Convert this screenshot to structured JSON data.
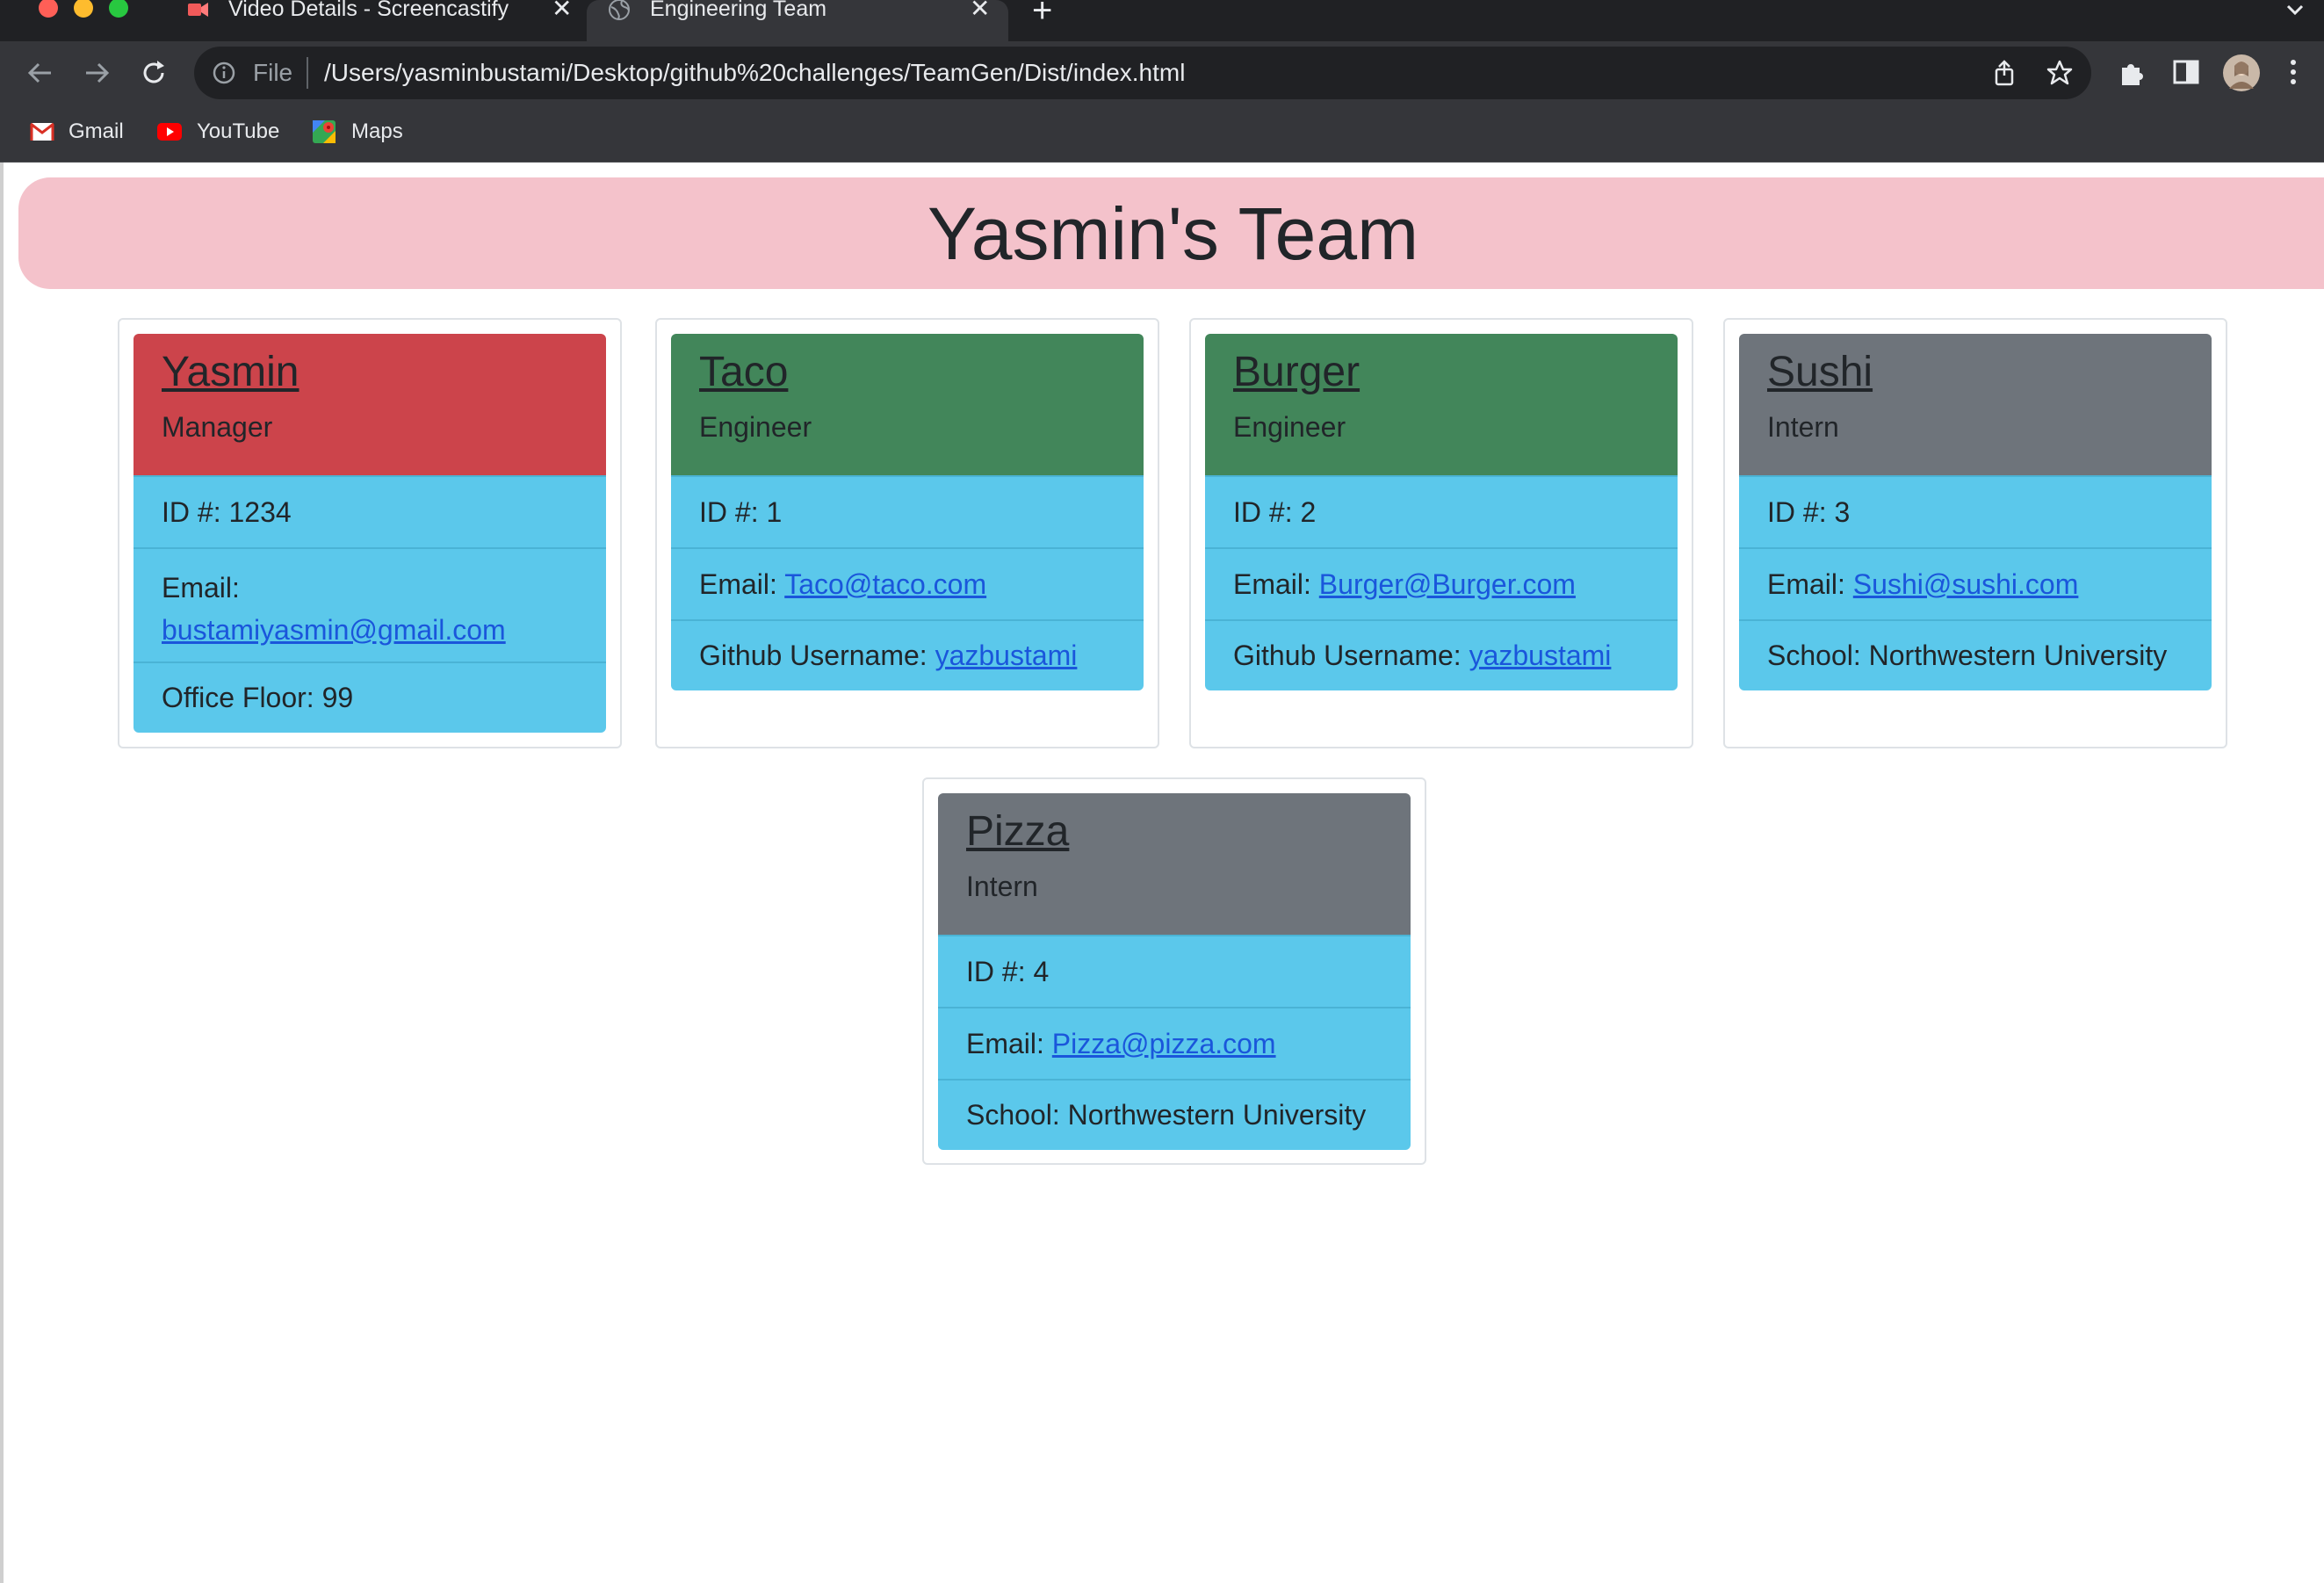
{
  "browser": {
    "tabs": [
      {
        "title": "Video Details - Screencastify",
        "active": false
      },
      {
        "title": "Engineering Team",
        "active": true
      }
    ],
    "address": {
      "scheme_label": "File",
      "url": "/Users/yasminbustami/Desktop/github%20challenges/TeamGen/Dist/index.html"
    },
    "bookmarks": [
      {
        "label": "Gmail",
        "icon": "gmail-icon"
      },
      {
        "label": "YouTube",
        "icon": "youtube-icon"
      },
      {
        "label": "Maps",
        "icon": "maps-icon"
      }
    ]
  },
  "page": {
    "title": "Yasmin's Team",
    "cards": [
      {
        "name": "Yasmin",
        "role": "Manager",
        "header_color": "#cc444b",
        "rows": [
          {
            "label": "ID #:",
            "value": "1234"
          },
          {
            "label": "Email:",
            "value": "bustamiyasmin@gmail.com",
            "link": true
          },
          {
            "label": "Office Floor:",
            "value": "99"
          }
        ]
      },
      {
        "name": "Taco",
        "role": "Engineer",
        "header_color": "#42865a",
        "rows": [
          {
            "label": "ID #:",
            "value": "1"
          },
          {
            "label": "Email:",
            "value": "Taco@taco.com",
            "link": true
          },
          {
            "label": "Github Username:",
            "value": "yazbustami",
            "link": true
          }
        ]
      },
      {
        "name": "Burger",
        "role": "Engineer",
        "header_color": "#42865a",
        "rows": [
          {
            "label": "ID #:",
            "value": "2"
          },
          {
            "label": "Email:",
            "value": "Burger@Burger.com",
            "link": true
          },
          {
            "label": "Github Username:",
            "value": "yazbustami",
            "link": true
          }
        ]
      },
      {
        "name": "Sushi",
        "role": "Intern",
        "header_color": "#6e747b",
        "rows": [
          {
            "label": "ID #:",
            "value": "3"
          },
          {
            "label": "Email:",
            "value": "Sushi@sushi.com",
            "link": true
          },
          {
            "label": "School:",
            "value": "Northwestern University"
          }
        ]
      },
      {
        "name": "Pizza",
        "role": "Intern",
        "header_color": "#6e747b",
        "rows": [
          {
            "label": "ID #:",
            "value": "4"
          },
          {
            "label": "Email:",
            "value": "Pizza@pizza.com",
            "link": true
          },
          {
            "label": "School:",
            "value": "Northwestern University"
          }
        ]
      }
    ]
  }
}
